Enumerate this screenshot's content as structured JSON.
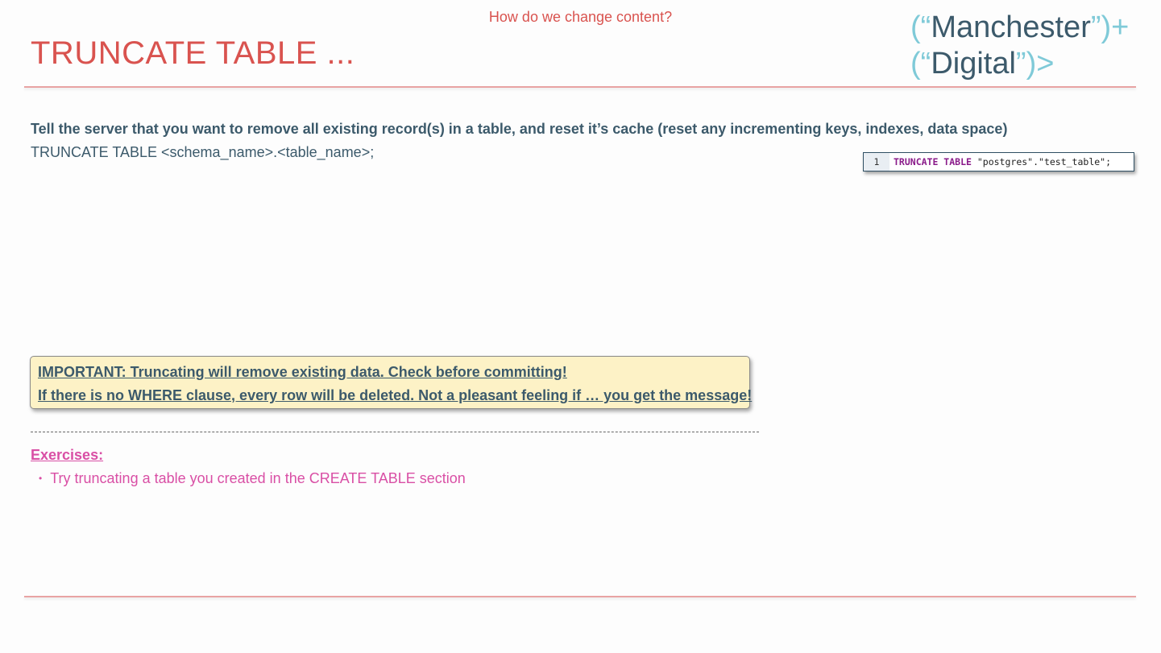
{
  "header": {
    "section_label": "How do we change content?",
    "title": "TRUNCATE TABLE ...",
    "logo": {
      "line1_open": "(“",
      "line1_word": "Manchester",
      "line1_close": "”)+",
      "line2_open": "(“",
      "line2_word": "Digital",
      "line2_close": "”)>"
    }
  },
  "body": {
    "description": "Tell the server that you want to remove all existing record(s) in a table, and reset it’s cache (reset any incrementing keys, indexes, data space)",
    "syntax": "TRUNCATE TABLE <schema_name>.<table_name>;"
  },
  "code_example": {
    "line_number": "1",
    "keyword": "TRUNCATE TABLE",
    "rest": " \"postgres\".\"test_table\";"
  },
  "warning": {
    "line1": "IMPORTANT: Truncating will remove existing data.  Check before committing!",
    "line2": "If there is no WHERE clause, every row will be deleted.  Not a pleasant feeling if … you get the message!"
  },
  "exercises": {
    "heading": "Exercises:",
    "items": [
      {
        "bullet": "•",
        "text": "Try truncating a table you created in the CREATE TABLE section"
      }
    ]
  },
  "colors": {
    "title_red": "#d9534f",
    "body_slate": "#3c5a6b",
    "logo_cyan": "#7fcad8",
    "exercise_pink": "#d94fa5",
    "warning_bg": "#fdf2c6"
  }
}
